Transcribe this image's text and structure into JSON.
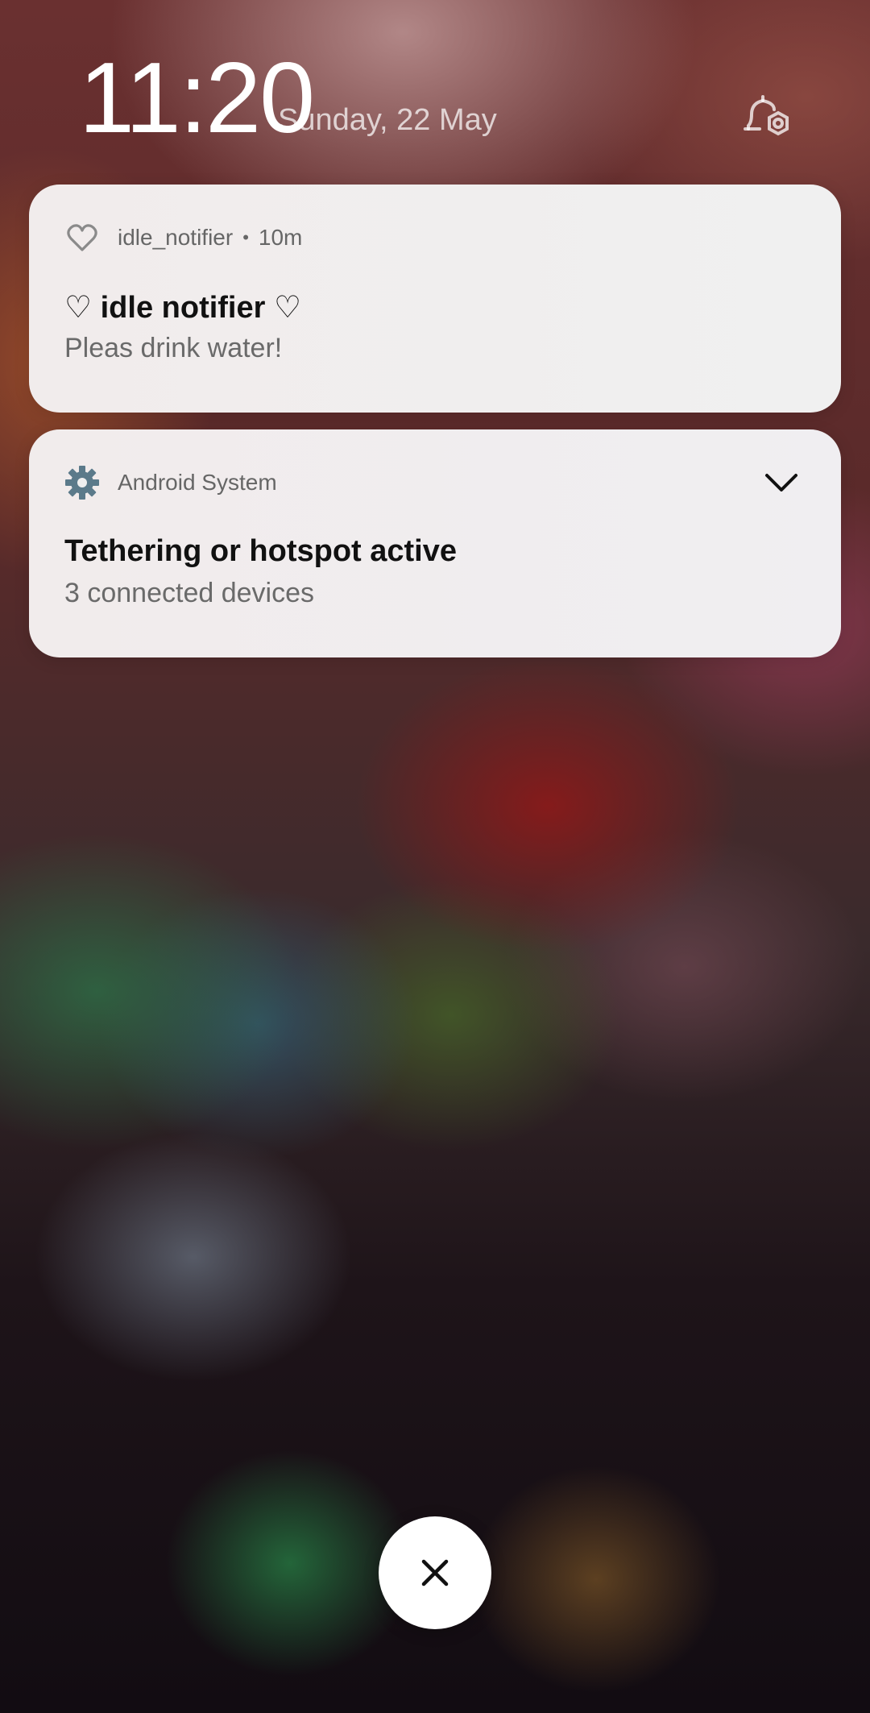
{
  "lockscreen": {
    "time": "11:20",
    "date": "Sunday, 22 May"
  },
  "notifications": [
    {
      "app_icon": "heart-outline-icon",
      "app_name": "idle_notifier",
      "separator": "•",
      "time": "10m",
      "title": "♡ idle notifier ♡",
      "text": "Pleas drink water!"
    },
    {
      "app_icon": "gear-icon",
      "app_name": "Android System",
      "title": "Tethering or hotspot active",
      "text": "3 connected devices",
      "expand_icon": "chevron-down-icon"
    }
  ],
  "actions": {
    "notification_settings_icon": "bell-gear-icon",
    "clear_all_icon": "close-icon"
  },
  "colors": {
    "card_bg": "#efefef",
    "gear_icon": "#5b7a8a",
    "title_text": "#111111",
    "body_text": "#6a6a6a"
  }
}
